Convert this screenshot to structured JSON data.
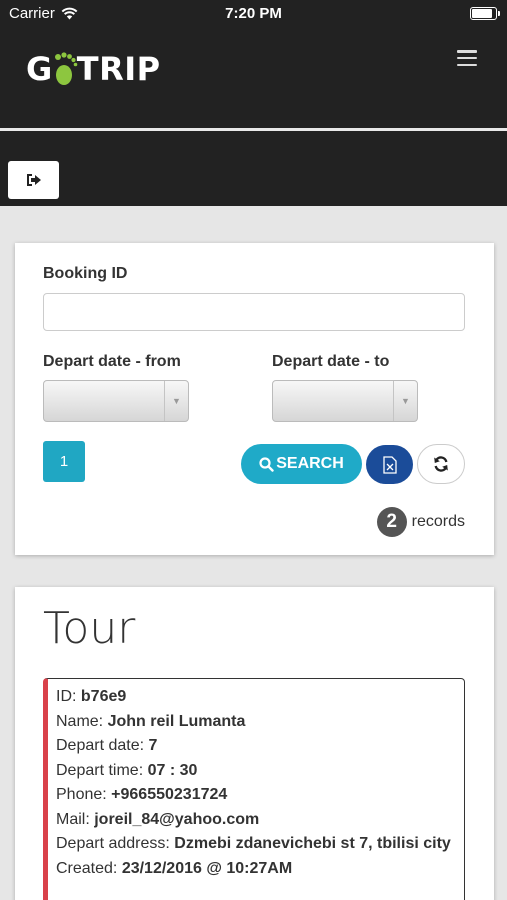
{
  "status_bar": {
    "carrier": "Carrier",
    "time": "7:20 PM"
  },
  "header": {
    "logo_prefix": "G",
    "logo_suffix": "TRIP",
    "menu_icon": "hamburger-icon",
    "logout_icon": "sign-out-icon"
  },
  "search": {
    "booking_id_label": "Booking ID",
    "booking_id_value": "",
    "depart_from_label": "Depart date - from",
    "depart_to_label": "Depart date - to",
    "page_number": "1",
    "search_label": "SEARCH",
    "records_count": "2",
    "records_label": "records"
  },
  "tour": {
    "title": "Tour",
    "booking": {
      "id_label": "ID: ",
      "id": "b76e9",
      "name_label": "Name: ",
      "name": "John reil Lumanta",
      "depart_date_label": "Depart date: ",
      "depart_date": "7",
      "depart_time_label": "Depart time: ",
      "depart_time": "07 : 30",
      "phone_label": "Phone: ",
      "phone": "+966550231724",
      "mail_label": "Mail: ",
      "mail": "joreil_84@yahoo.com",
      "address_label": "Depart address: ",
      "address": "Dzmebi zdanevichebi st 7, tbilisi city",
      "created_label": "Created: ",
      "created": "23/12/2016 @ 10:27AM"
    }
  },
  "colors": {
    "header_bg": "#222222",
    "accent": "#1faac8",
    "excel_button": "#1b4c99",
    "logo_foot": "#8dc63f",
    "booking_border": "#d9414a"
  }
}
